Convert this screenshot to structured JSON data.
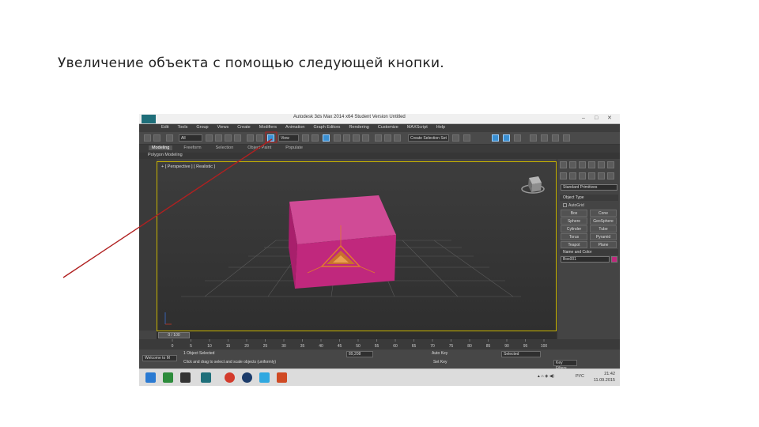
{
  "slide": {
    "title": "Увеличение объекта с помощью следующей кнопки."
  },
  "window": {
    "title": "Autodesk 3ds Max 2014 x64 Student Version Untitled",
    "menu": [
      "Edit",
      "Tools",
      "Group",
      "Views",
      "Create",
      "Modifiers",
      "Animation",
      "Graph Editors",
      "Rendering",
      "Customize",
      "MAXScript",
      "Help"
    ]
  },
  "toolbar": {
    "filter_value": "All",
    "view_value": "View",
    "selection_set": "Create Selection Set"
  },
  "ribbon": {
    "tabs": [
      "Modeling",
      "Freeform",
      "Selection",
      "Object Paint",
      "Populate"
    ],
    "active_tab": "Modeling",
    "panel_label": "Polygon Modeling"
  },
  "viewport": {
    "label": "+ [ Perspective ] [ Realistic ]"
  },
  "command_panel": {
    "category": "Standard Primitives",
    "object_type_header": "Object Type",
    "autogrid_label": "AutoGrid",
    "primitives": [
      "Box",
      "Cone",
      "Sphere",
      "GeoSphere",
      "Cylinder",
      "Tube",
      "Torus",
      "Pyramid",
      "Teapot",
      "Plane"
    ],
    "name_color_header": "Name and Color",
    "object_name": "Box001",
    "object_color": "#c0287d"
  },
  "timeline": {
    "slider_label": "0 / 100",
    "ticks": [
      "0",
      "5",
      "10",
      "15",
      "20",
      "25",
      "30",
      "35",
      "40",
      "45",
      "50",
      "55",
      "60",
      "65",
      "70",
      "75",
      "80",
      "85",
      "90",
      "95",
      "100"
    ]
  },
  "status": {
    "maxscript": "Welcome to M",
    "selected": "1 Object Selected",
    "prompt": "Click and drag to select and scale objects (uniformly)",
    "x_value": "89,208",
    "auto_key": "Auto Key",
    "set_key": "Set Key",
    "selected_dropdown": "Selected",
    "key_filters": "Key Filters..."
  },
  "taskbar": {
    "lang": "РУС",
    "time": "21:42",
    "date": "11.09.2015"
  },
  "colors": {
    "box_face": "#c0287d",
    "box_top": "#d04b96",
    "gizmo": "#e07a2e",
    "annotation_arrow": "#b02020",
    "viewport_border": "#c8b400"
  }
}
